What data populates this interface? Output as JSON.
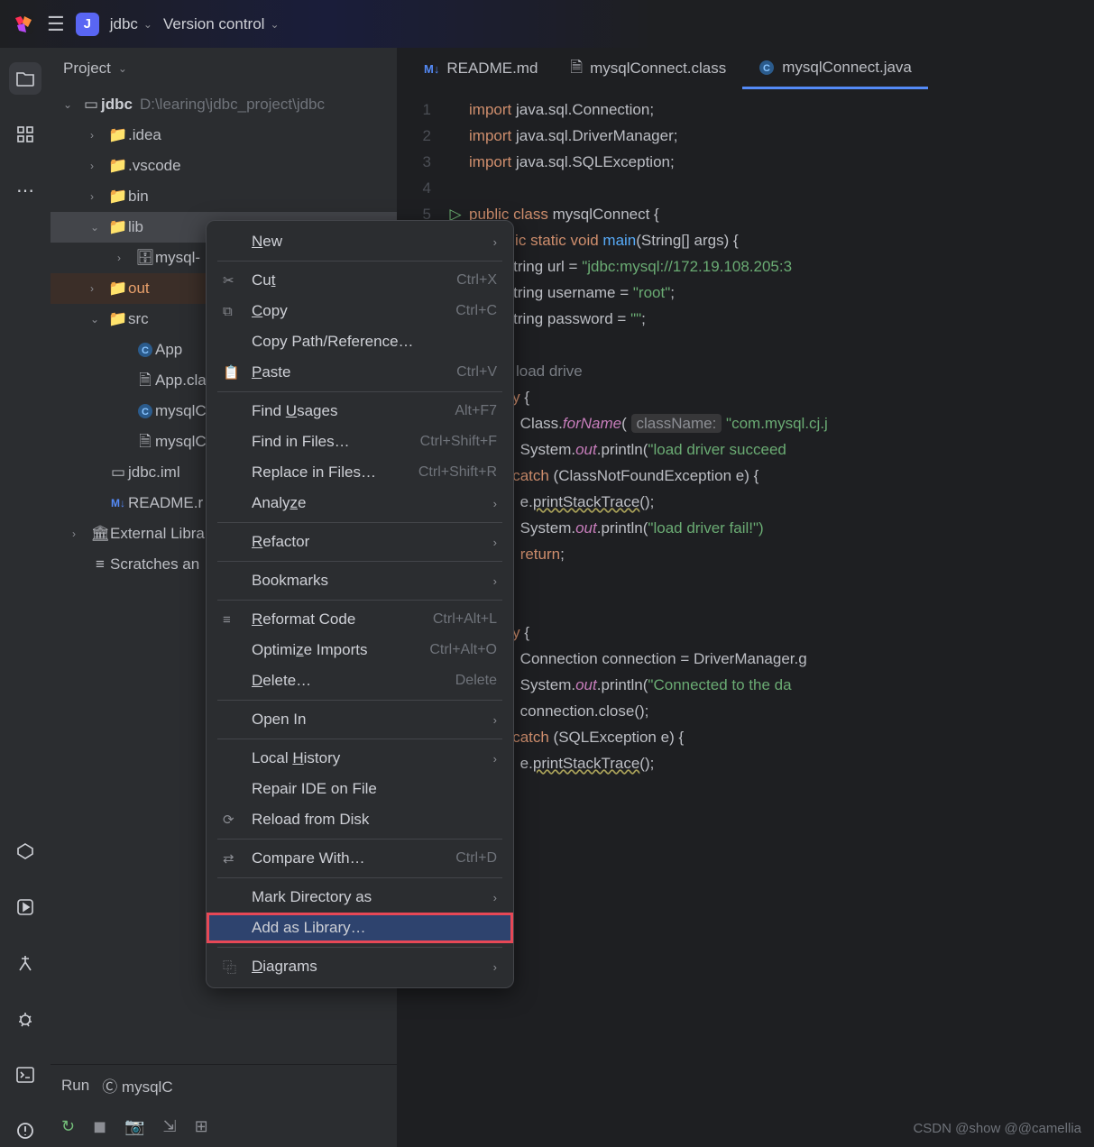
{
  "top": {
    "project_letter": "J",
    "project_name": "jdbc",
    "version_control": "Version control"
  },
  "panel": {
    "title": "Project"
  },
  "tree": {
    "root": "jdbc",
    "root_path": "D:\\learing\\jdbc_project\\jdbc",
    "idea": ".idea",
    "vscode": ".vscode",
    "bin": "bin",
    "lib": "lib",
    "mysql": "mysql-",
    "out": "out",
    "src": "src",
    "app": "App",
    "app_cla": "App.cla",
    "mysqlc1": "mysqlC",
    "mysqlc2": "mysqlC",
    "iml": "jdbc.iml",
    "readme": "README.r",
    "ext": "External Libra",
    "scratch": "Scratches an"
  },
  "tabs": {
    "readme": "README.md",
    "class": "mysqlConnect.class",
    "java": "mysqlConnect.java"
  },
  "code": {
    "l1": "import java.sql.Connection;",
    "l2": "import java.sql.DriverManager;",
    "l3": "import java.sql.SQLException;",
    "l5a": "public",
    "l5b": "class",
    "l5c": "mysqlConnect {",
    "l6a": "public",
    "l6b": "static",
    "l6c": "void",
    "l6d": "main",
    "l6e": "(String[] args) {",
    "l7a": "String url =",
    "l7b": "\"jdbc:mysql://172.19.108.205:3",
    "l8a": "String username =",
    "l8b": "\"root\"",
    "l8c": ";",
    "l9a": "String password =",
    "l9b": "\"\"",
    "l9c": ";",
    "l11": "// load drive",
    "l12a": "try",
    "l12b": " {",
    "l13a": "Class.",
    "l13b": "forName",
    "l13c": "(",
    "l13d": "className:",
    "l13e": "\"com.mysql.cj.j",
    "l14a": "System.",
    "l14b": "out",
    "l14c": ".println(",
    "l14d": "\"load driver succeed",
    "l15a": "} ",
    "l15b": "catch",
    "l15c": " (ClassNotFoundException e) {",
    "l16a": "e.",
    "l16b": "printStackTrace",
    "l16c": "();",
    "l17a": "System.",
    "l17b": "out",
    "l17c": ".println(",
    "l17d": "\"load driver fail!\")",
    "l18a": "return",
    "l18b": ";",
    "l19": "}",
    "l21a": "try",
    "l21b": " {",
    "l22a": "Connection connection = DriverManager.g",
    "l23a": "System.",
    "l23b": "out",
    "l23c": ".println(",
    "l23d": "\"Connected to the da",
    "l24": "connection.close();",
    "l25a": "} ",
    "l25b": "catch",
    "l25c": " (SQLException e) {",
    "l26a": "e.",
    "l26b": "printStackTrace",
    "l26c": "();",
    "l27": "}",
    "l29": "}"
  },
  "ctx": {
    "new": "New",
    "cut": "Cut",
    "cut_s": "Ctrl+X",
    "copy": "Copy",
    "copy_s": "Ctrl+C",
    "copypath": "Copy Path/Reference…",
    "paste": "Paste",
    "paste_s": "Ctrl+V",
    "findu": "Find Usages",
    "findu_s": "Alt+F7",
    "findf": "Find in Files…",
    "findf_s": "Ctrl+Shift+F",
    "repl": "Replace in Files…",
    "repl_s": "Ctrl+Shift+R",
    "analyze": "Analyze",
    "refactor": "Refactor",
    "bookmarks": "Bookmarks",
    "reformat": "Reformat Code",
    "reformat_s": "Ctrl+Alt+L",
    "optimize": "Optimize Imports",
    "optimize_s": "Ctrl+Alt+O",
    "delete": "Delete…",
    "delete_s": "Delete",
    "openin": "Open In",
    "history": "Local History",
    "repair": "Repair IDE on File",
    "reload": "Reload from Disk",
    "compare": "Compare With…",
    "compare_s": "Ctrl+D",
    "markdir": "Mark Directory as",
    "addlib": "Add as Library…",
    "diagrams": "Diagrams"
  },
  "run": {
    "label": "Run",
    "config": "mysqlC"
  },
  "watermark": "CSDN @show @@camellia"
}
